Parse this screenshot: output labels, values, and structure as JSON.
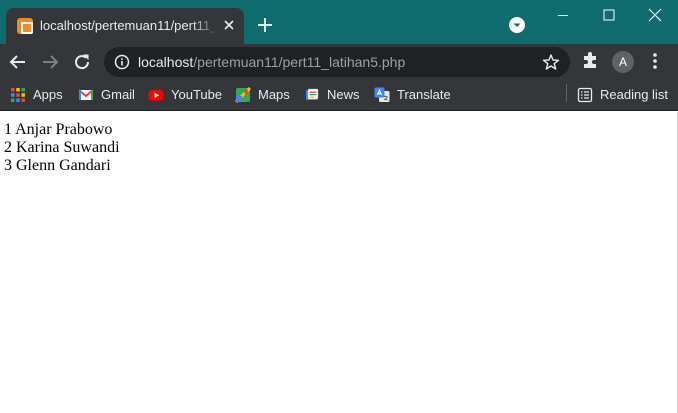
{
  "browser": {
    "tab": {
      "title": "localhost/pertemuan11/pert11_latihan5.php",
      "favicon": "xampp-icon"
    },
    "profile_initial": "A",
    "colors": {
      "titlebar": "#0e6b6e",
      "toolbar": "#35363a",
      "omnibox": "#202124"
    }
  },
  "address_bar": {
    "host": "localhost",
    "path": "/pertemuan11/pert11_latihan5.php"
  },
  "bookmarks": [
    {
      "label": "Apps",
      "icon": "apps-grid-icon"
    },
    {
      "label": "Gmail",
      "icon": "gmail-icon"
    },
    {
      "label": "YouTube",
      "icon": "youtube-icon"
    },
    {
      "label": "Maps",
      "icon": "maps-icon"
    },
    {
      "label": "News",
      "icon": "news-icon"
    },
    {
      "label": "Translate",
      "icon": "translate-icon"
    }
  ],
  "reading_list": {
    "label": "Reading list",
    "icon": "reading-list-icon"
  },
  "page": {
    "rows": [
      "1 Anjar Prabowo",
      "2 Karina Suwandi",
      "3 Glenn Gandari"
    ]
  }
}
